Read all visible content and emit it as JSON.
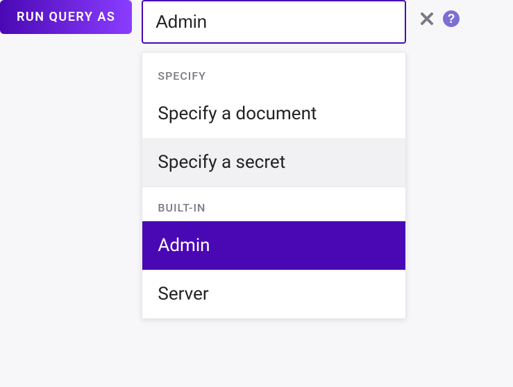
{
  "badge": {
    "label": "RUN QUERY AS"
  },
  "input": {
    "value": "Admin"
  },
  "dropdown": {
    "sections": {
      "specify": {
        "header": "SPECIFY",
        "options": {
          "document": "Specify a document",
          "secret": "Specify a secret"
        }
      },
      "builtin": {
        "header": "BUILT-IN",
        "options": {
          "admin": "Admin",
          "server": "Server"
        }
      }
    }
  },
  "colors": {
    "accent": "#4a08b5",
    "gradient_end": "#8b3dff",
    "muted": "#7a7a85",
    "hover_bg": "#f1f1f3"
  }
}
